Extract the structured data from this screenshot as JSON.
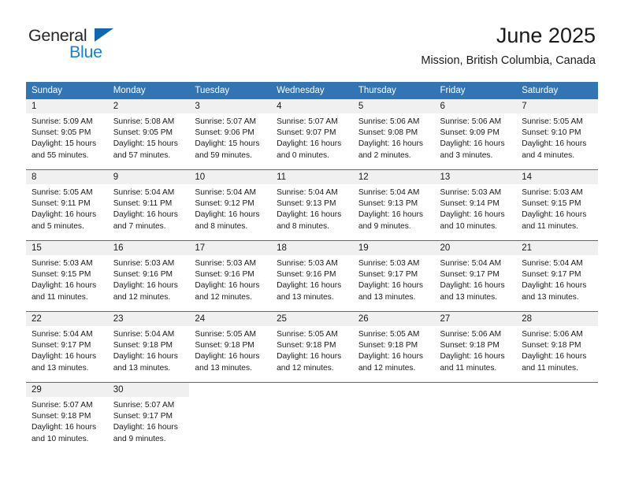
{
  "brand": {
    "name_part1": "General",
    "name_part2": "Blue",
    "triangle_color": "#1267b2",
    "blue_text_color": "#1a7fd4"
  },
  "header": {
    "title": "June 2025",
    "subtitle": "Mission, British Columbia, Canada"
  },
  "colors": {
    "header_blue": "#3375b4",
    "daynum_gray": "#f0f0f0",
    "text": "#1a1a1a"
  },
  "weekdays": [
    "Sunday",
    "Monday",
    "Tuesday",
    "Wednesday",
    "Thursday",
    "Friday",
    "Saturday"
  ],
  "weeks": [
    [
      {
        "day": "1",
        "sunrise": "Sunrise: 5:09 AM",
        "sunset": "Sunset: 9:05 PM",
        "daylight1": "Daylight: 15 hours",
        "daylight2": "and 55 minutes."
      },
      {
        "day": "2",
        "sunrise": "Sunrise: 5:08 AM",
        "sunset": "Sunset: 9:05 PM",
        "daylight1": "Daylight: 15 hours",
        "daylight2": "and 57 minutes."
      },
      {
        "day": "3",
        "sunrise": "Sunrise: 5:07 AM",
        "sunset": "Sunset: 9:06 PM",
        "daylight1": "Daylight: 15 hours",
        "daylight2": "and 59 minutes."
      },
      {
        "day": "4",
        "sunrise": "Sunrise: 5:07 AM",
        "sunset": "Sunset: 9:07 PM",
        "daylight1": "Daylight: 16 hours",
        "daylight2": "and 0 minutes."
      },
      {
        "day": "5",
        "sunrise": "Sunrise: 5:06 AM",
        "sunset": "Sunset: 9:08 PM",
        "daylight1": "Daylight: 16 hours",
        "daylight2": "and 2 minutes."
      },
      {
        "day": "6",
        "sunrise": "Sunrise: 5:06 AM",
        "sunset": "Sunset: 9:09 PM",
        "daylight1": "Daylight: 16 hours",
        "daylight2": "and 3 minutes."
      },
      {
        "day": "7",
        "sunrise": "Sunrise: 5:05 AM",
        "sunset": "Sunset: 9:10 PM",
        "daylight1": "Daylight: 16 hours",
        "daylight2": "and 4 minutes."
      }
    ],
    [
      {
        "day": "8",
        "sunrise": "Sunrise: 5:05 AM",
        "sunset": "Sunset: 9:11 PM",
        "daylight1": "Daylight: 16 hours",
        "daylight2": "and 5 minutes."
      },
      {
        "day": "9",
        "sunrise": "Sunrise: 5:04 AM",
        "sunset": "Sunset: 9:11 PM",
        "daylight1": "Daylight: 16 hours",
        "daylight2": "and 7 minutes."
      },
      {
        "day": "10",
        "sunrise": "Sunrise: 5:04 AM",
        "sunset": "Sunset: 9:12 PM",
        "daylight1": "Daylight: 16 hours",
        "daylight2": "and 8 minutes."
      },
      {
        "day": "11",
        "sunrise": "Sunrise: 5:04 AM",
        "sunset": "Sunset: 9:13 PM",
        "daylight1": "Daylight: 16 hours",
        "daylight2": "and 8 minutes."
      },
      {
        "day": "12",
        "sunrise": "Sunrise: 5:04 AM",
        "sunset": "Sunset: 9:13 PM",
        "daylight1": "Daylight: 16 hours",
        "daylight2": "and 9 minutes."
      },
      {
        "day": "13",
        "sunrise": "Sunrise: 5:03 AM",
        "sunset": "Sunset: 9:14 PM",
        "daylight1": "Daylight: 16 hours",
        "daylight2": "and 10 minutes."
      },
      {
        "day": "14",
        "sunrise": "Sunrise: 5:03 AM",
        "sunset": "Sunset: 9:15 PM",
        "daylight1": "Daylight: 16 hours",
        "daylight2": "and 11 minutes."
      }
    ],
    [
      {
        "day": "15",
        "sunrise": "Sunrise: 5:03 AM",
        "sunset": "Sunset: 9:15 PM",
        "daylight1": "Daylight: 16 hours",
        "daylight2": "and 11 minutes."
      },
      {
        "day": "16",
        "sunrise": "Sunrise: 5:03 AM",
        "sunset": "Sunset: 9:16 PM",
        "daylight1": "Daylight: 16 hours",
        "daylight2": "and 12 minutes."
      },
      {
        "day": "17",
        "sunrise": "Sunrise: 5:03 AM",
        "sunset": "Sunset: 9:16 PM",
        "daylight1": "Daylight: 16 hours",
        "daylight2": "and 12 minutes."
      },
      {
        "day": "18",
        "sunrise": "Sunrise: 5:03 AM",
        "sunset": "Sunset: 9:16 PM",
        "daylight1": "Daylight: 16 hours",
        "daylight2": "and 13 minutes."
      },
      {
        "day": "19",
        "sunrise": "Sunrise: 5:03 AM",
        "sunset": "Sunset: 9:17 PM",
        "daylight1": "Daylight: 16 hours",
        "daylight2": "and 13 minutes."
      },
      {
        "day": "20",
        "sunrise": "Sunrise: 5:04 AM",
        "sunset": "Sunset: 9:17 PM",
        "daylight1": "Daylight: 16 hours",
        "daylight2": "and 13 minutes."
      },
      {
        "day": "21",
        "sunrise": "Sunrise: 5:04 AM",
        "sunset": "Sunset: 9:17 PM",
        "daylight1": "Daylight: 16 hours",
        "daylight2": "and 13 minutes."
      }
    ],
    [
      {
        "day": "22",
        "sunrise": "Sunrise: 5:04 AM",
        "sunset": "Sunset: 9:17 PM",
        "daylight1": "Daylight: 16 hours",
        "daylight2": "and 13 minutes."
      },
      {
        "day": "23",
        "sunrise": "Sunrise: 5:04 AM",
        "sunset": "Sunset: 9:18 PM",
        "daylight1": "Daylight: 16 hours",
        "daylight2": "and 13 minutes."
      },
      {
        "day": "24",
        "sunrise": "Sunrise: 5:05 AM",
        "sunset": "Sunset: 9:18 PM",
        "daylight1": "Daylight: 16 hours",
        "daylight2": "and 13 minutes."
      },
      {
        "day": "25",
        "sunrise": "Sunrise: 5:05 AM",
        "sunset": "Sunset: 9:18 PM",
        "daylight1": "Daylight: 16 hours",
        "daylight2": "and 12 minutes."
      },
      {
        "day": "26",
        "sunrise": "Sunrise: 5:05 AM",
        "sunset": "Sunset: 9:18 PM",
        "daylight1": "Daylight: 16 hours",
        "daylight2": "and 12 minutes."
      },
      {
        "day": "27",
        "sunrise": "Sunrise: 5:06 AM",
        "sunset": "Sunset: 9:18 PM",
        "daylight1": "Daylight: 16 hours",
        "daylight2": "and 11 minutes."
      },
      {
        "day": "28",
        "sunrise": "Sunrise: 5:06 AM",
        "sunset": "Sunset: 9:18 PM",
        "daylight1": "Daylight: 16 hours",
        "daylight2": "and 11 minutes."
      }
    ],
    [
      {
        "day": "29",
        "sunrise": "Sunrise: 5:07 AM",
        "sunset": "Sunset: 9:18 PM",
        "daylight1": "Daylight: 16 hours",
        "daylight2": "and 10 minutes."
      },
      {
        "day": "30",
        "sunrise": "Sunrise: 5:07 AM",
        "sunset": "Sunset: 9:17 PM",
        "daylight1": "Daylight: 16 hours",
        "daylight2": "and 9 minutes."
      },
      {
        "day": "",
        "sunrise": "",
        "sunset": "",
        "daylight1": "",
        "daylight2": ""
      },
      {
        "day": "",
        "sunrise": "",
        "sunset": "",
        "daylight1": "",
        "daylight2": ""
      },
      {
        "day": "",
        "sunrise": "",
        "sunset": "",
        "daylight1": "",
        "daylight2": ""
      },
      {
        "day": "",
        "sunrise": "",
        "sunset": "",
        "daylight1": "",
        "daylight2": ""
      },
      {
        "day": "",
        "sunrise": "",
        "sunset": "",
        "daylight1": "",
        "daylight2": ""
      }
    ]
  ]
}
